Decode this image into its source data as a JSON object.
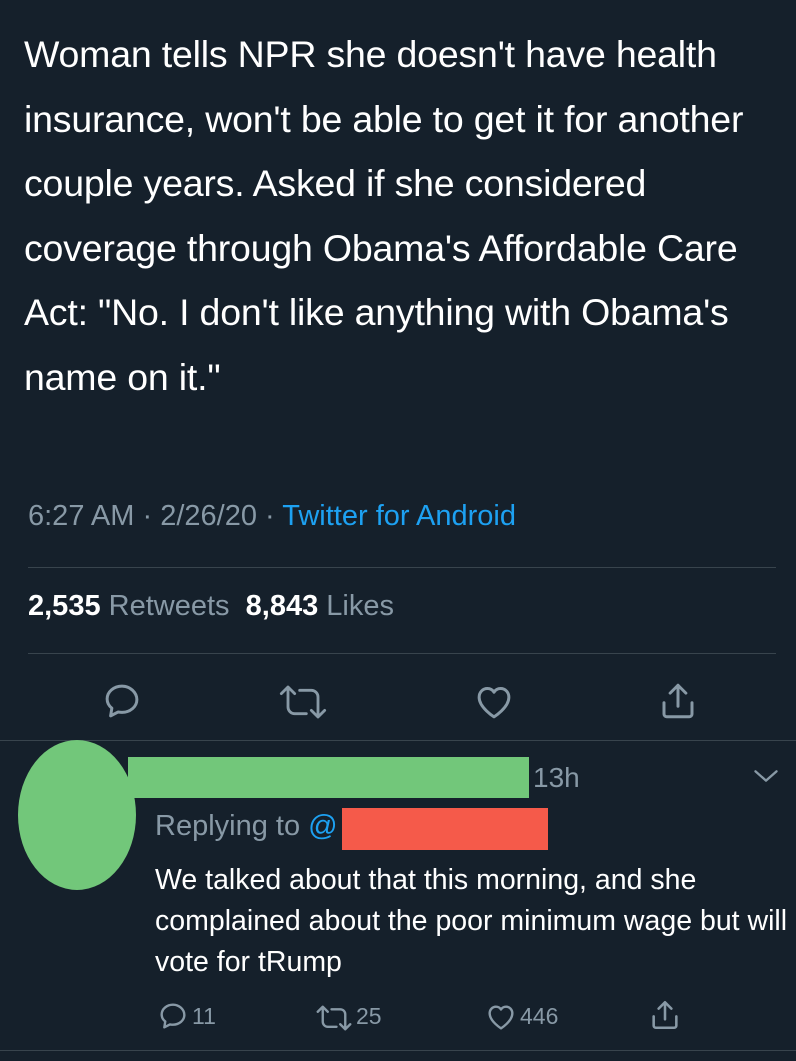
{
  "tweet": {
    "text": "Woman tells NPR she doesn't have health insurance, won't be able to get it for another couple years. Asked if she considered coverage through Obama's Affordable Care Act: \"No. I don't like anything with Obama's name on it.\"",
    "time": "6:27 AM",
    "date": "2/26/20",
    "separator": "·",
    "source": "Twitter for Android",
    "retweets_count": "2,535",
    "retweets_label": "Retweets",
    "likes_count": "8,843",
    "likes_label": "Likes"
  },
  "reply": {
    "time_ago": "13h",
    "replying_label": "Replying to",
    "at_symbol": "@",
    "text": "We talked about that this morning, and she complained about the poor minimum wage but will vote for tRump",
    "reply_count": "11",
    "retweet_count": "25",
    "like_count": "446"
  },
  "colors": {
    "background": "#15202b",
    "secondary_text": "#8899a6",
    "link": "#1da1f2",
    "divider": "#38444d",
    "redaction_green": "#72c77a",
    "redaction_red": "#f55a4a"
  },
  "icons": [
    "reply-icon",
    "retweet-icon",
    "like-icon",
    "share-icon",
    "chevron-down-icon"
  ]
}
